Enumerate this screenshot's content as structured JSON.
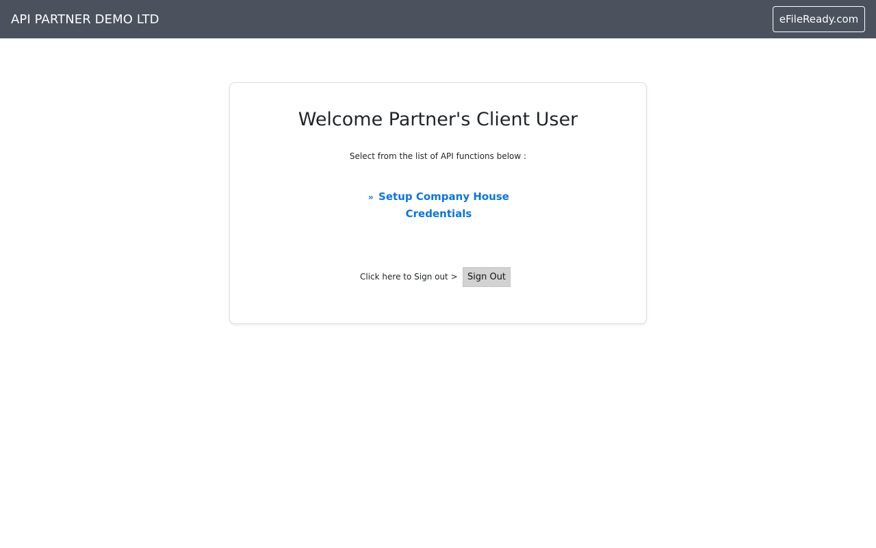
{
  "header": {
    "brand": "API PARTNER DEMO LTD",
    "site_button_label": "eFileReady.com",
    "background_color": "#4b525e"
  },
  "card": {
    "title": "Welcome Partner's Client User",
    "subtitle": "Select from the list of API functions below :",
    "functions": [
      {
        "prefix": "»",
        "line1": "Setup Company House",
        "line2": "Credentials"
      }
    ],
    "signout_label": "Click here to Sign out >",
    "signout_button_label": "Sign Out"
  },
  "colors": {
    "link": "#0a74e8",
    "button_gray": "#d2d2d2"
  }
}
